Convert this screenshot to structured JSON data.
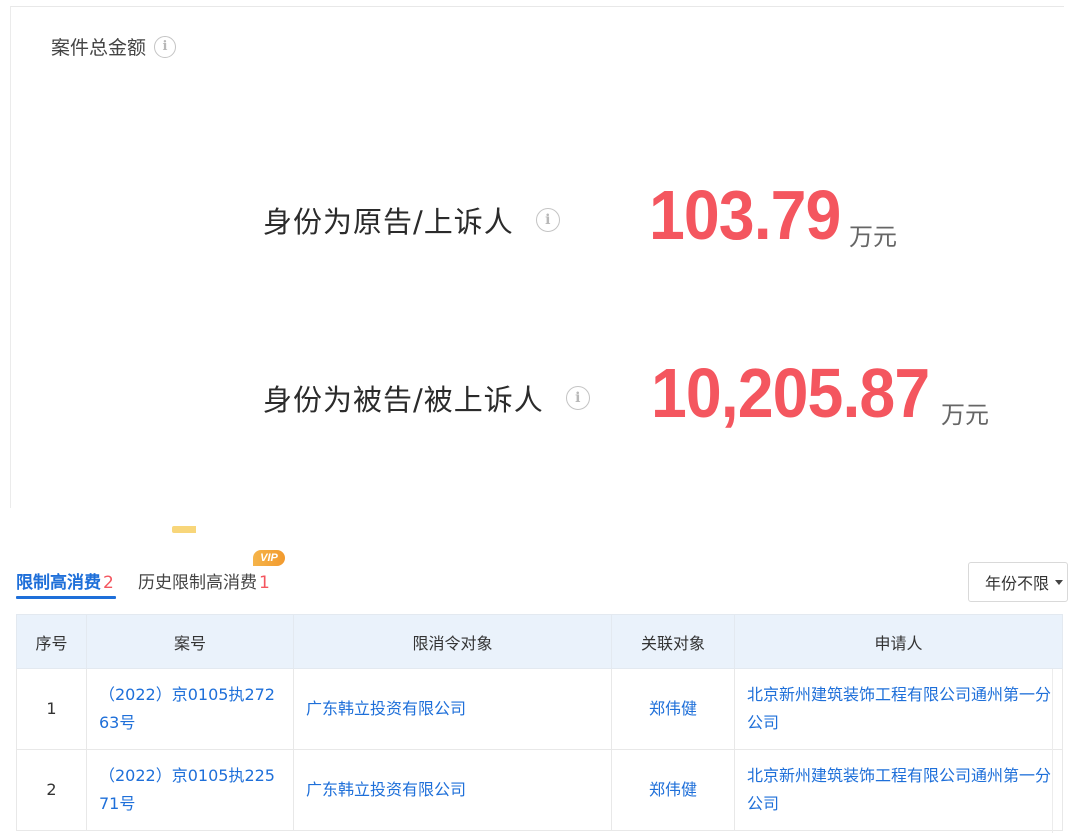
{
  "summary": {
    "title": "案件总金额",
    "info_glyph": "i",
    "plaintiff": {
      "label": "身份为原告/上诉人",
      "value": "103.79",
      "unit": "万元"
    },
    "defendant": {
      "label": "身份为被告/被上诉人",
      "value": "10,205.87",
      "unit": "万元"
    },
    "accent_color": "#f4565f"
  },
  "tabs": [
    {
      "label": "限制高消费",
      "count": "2",
      "active": true
    },
    {
      "label": "历史限制高消费",
      "count": "1",
      "active": false,
      "badge": "VIP"
    }
  ],
  "filter": {
    "label": "年份不限"
  },
  "table": {
    "headers": [
      "序号",
      "案号",
      "限消令对象",
      "关联对象",
      "申请人"
    ],
    "rows": [
      {
        "seq": "1",
        "case_no": "（2022）京0105执27263号",
        "target": "广东韩立投资有限公司",
        "related": "郑伟健",
        "applicant": "北京新州建筑装饰工程有限公司通州第一分公司"
      },
      {
        "seq": "2",
        "case_no": "（2022）京0105执22571号",
        "target": "广东韩立投资有限公司",
        "related": "郑伟健",
        "applicant": "北京新州建筑装饰工程有限公司通州第一分公司"
      }
    ]
  },
  "colors": {
    "link": "#1e6fd9",
    "header_bg": "#eaf2fb",
    "count": "#f4565f"
  }
}
